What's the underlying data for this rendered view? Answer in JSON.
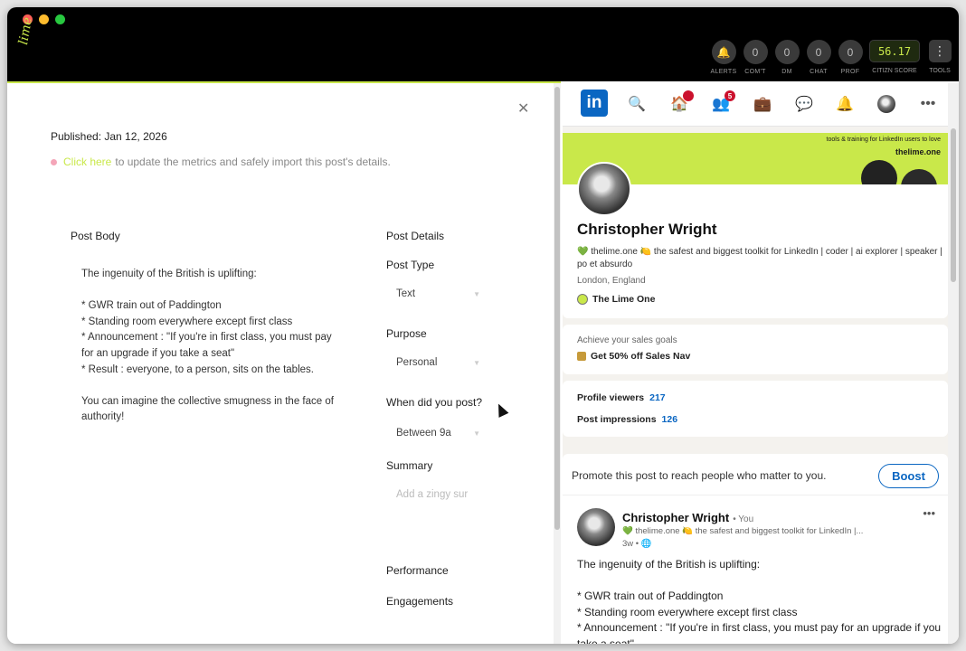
{
  "app": {
    "brand": "lime"
  },
  "stats": [
    {
      "value": "",
      "label": "ALERTS",
      "icon": "bell-icon"
    },
    {
      "value": "0",
      "label": "COM'T"
    },
    {
      "value": "0",
      "label": "DM"
    },
    {
      "value": "0",
      "label": "CHAT"
    },
    {
      "value": "0",
      "label": "PROF"
    }
  ],
  "score": {
    "value": "56.17",
    "label": "CITIZN SCORE"
  },
  "tools": {
    "label": "TOOLS",
    "icon": "more-vertical-icon"
  },
  "editor": {
    "published": "Published: Jan 12, 2026",
    "import_link": "Click here",
    "import_text": "to update the metrics and safely import this post's details.",
    "post_body_title": "Post Body",
    "post_body": "The ingenuity of the British is uplifting:\n\n* GWR train out of Paddington\n* Standing room everywhere except first class\n* Announcement : \"If you're in first class, you must pay for an upgrade if you take a seat\"\n* Result : everyone, to a person, sits on the tables.\n\nYou can imagine the collective smugness in the face of authority!",
    "details_title": "Post Details",
    "post_type_label": "Post Type",
    "post_type_value": "Text",
    "purpose_label": "Purpose",
    "purpose_value": "Personal",
    "when_label": "When did you post?",
    "when_value": "Between 9a",
    "summary_label": "Summary",
    "summary_placeholder": "Add a zingy sur",
    "performance_label": "Performance",
    "engagements_label": "Engagements"
  },
  "linkedin": {
    "logo": "in",
    "nav_badges": {
      "home": "",
      "network": "5"
    },
    "banner_tag": "tools & training for LinkedIn users to love",
    "banner_site": "thelime.one",
    "profile_name": "Christopher Wright",
    "profile_headline": "💚 thelime.one 🍋 the safest and biggest toolkit for LinkedIn | coder | ai explorer | speaker | po et absurdo",
    "profile_location": "London, England",
    "profile_org": "The Lime One",
    "sales_line1": "Achieve your sales goals",
    "sales_line2": "Get 50% off Sales Nav",
    "profile_viewers_label": "Profile viewers",
    "profile_viewers_value": "217",
    "post_impressions_label": "Post impressions",
    "post_impressions_value": "126",
    "promo_text": "Promote this post to reach people who matter to you.",
    "boost_label": "Boost",
    "post_author": "Christopher Wright",
    "post_you": "• You",
    "post_headline": "💚 thelime.one 🍋 the safest and biggest toolkit for LinkedIn |...",
    "post_time": "3w • 🌐",
    "post_body": "The ingenuity of the British is uplifting:\n\n* GWR train out of Paddington\n* Standing room everywhere except first class\n* Announcement : \"If you're in first class, you must pay for an upgrade if you take a seat\""
  }
}
